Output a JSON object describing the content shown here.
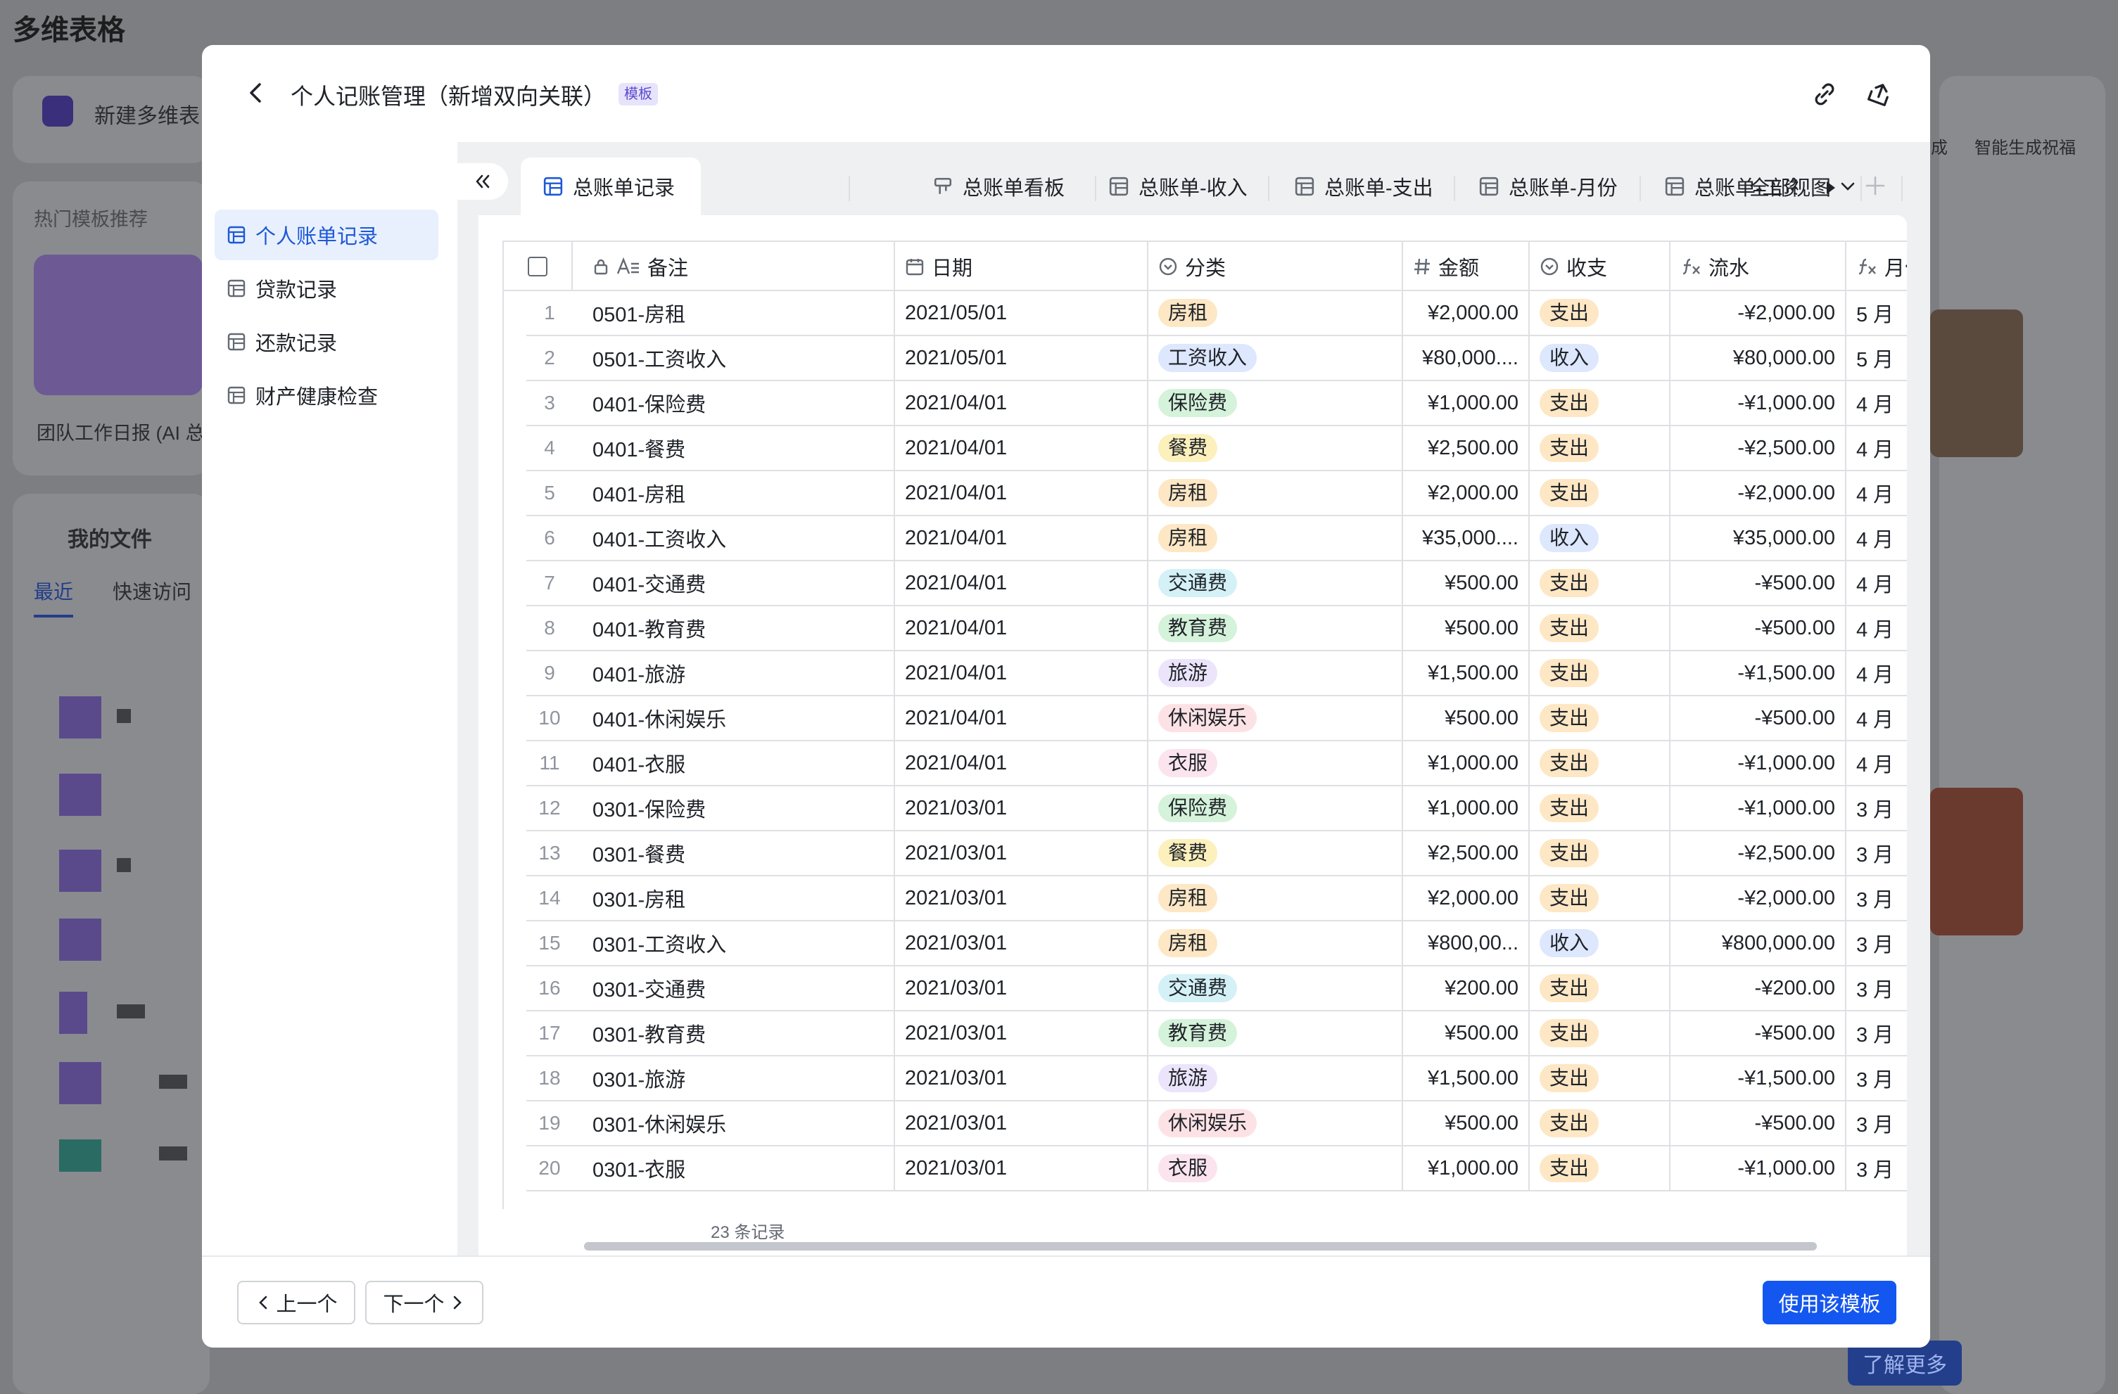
{
  "background": {
    "app_title": "多维表格",
    "new_label": "新建多维表",
    "hot_templates": "热门模板推荐",
    "template_card": "团队工作日报 (AI 总",
    "my_files": "我的文件",
    "tab_recent": "最近",
    "tab_quick": "快速访问",
    "right_text_1": "成",
    "right_text_2": "智能生成祝福",
    "learn_more": "了解更多"
  },
  "modal": {
    "title": "个人记账管理（新增双向关联）",
    "badge": "模板",
    "sidebar": [
      {
        "label": "个人账单记录",
        "active": true
      },
      {
        "label": "贷款记录",
        "active": false
      },
      {
        "label": "还款记录",
        "active": false
      },
      {
        "label": "财产健康检查",
        "active": false
      }
    ],
    "tabs": [
      {
        "label": "总账单记录",
        "icon": "grid-icon"
      },
      {
        "label": "总账单看板",
        "icon": "kanban-icon"
      },
      {
        "label": "总账单-收入",
        "icon": "grid-icon"
      },
      {
        "label": "总账单-支出",
        "icon": "grid-icon"
      },
      {
        "label": "总账单-月份",
        "icon": "grid-icon"
      },
      {
        "label": "总账单-工资",
        "icon": "grid-icon"
      }
    ],
    "all_views": "全部视图",
    "columns": {
      "note": "备注",
      "date": "日期",
      "category": "分类",
      "amount": "金额",
      "inout": "收支",
      "flow": "流水",
      "month": "月份"
    },
    "rows": [
      {
        "n": "1",
        "note": "0501-房租",
        "date": "2021/05/01",
        "cat": "房租",
        "amt": "¥2,000.00",
        "io": "支出",
        "flow": "-¥2,000.00",
        "mon": "5 月"
      },
      {
        "n": "2",
        "note": "0501-工资收入",
        "date": "2021/05/01",
        "cat": "工资收入",
        "amt": "¥80,000....",
        "io": "收入",
        "flow": "¥80,000.00",
        "mon": "5 月"
      },
      {
        "n": "3",
        "note": "0401-保险费",
        "date": "2021/04/01",
        "cat": "保险费",
        "amt": "¥1,000.00",
        "io": "支出",
        "flow": "-¥1,000.00",
        "mon": "4 月"
      },
      {
        "n": "4",
        "note": "0401-餐费",
        "date": "2021/04/01",
        "cat": "餐费",
        "amt": "¥2,500.00",
        "io": "支出",
        "flow": "-¥2,500.00",
        "mon": "4 月"
      },
      {
        "n": "5",
        "note": "0401-房租",
        "date": "2021/04/01",
        "cat": "房租",
        "amt": "¥2,000.00",
        "io": "支出",
        "flow": "-¥2,000.00",
        "mon": "4 月"
      },
      {
        "n": "6",
        "note": "0401-工资收入",
        "date": "2021/04/01",
        "cat": "房租",
        "amt": "¥35,000....",
        "io": "收入",
        "flow": "¥35,000.00",
        "mon": "4 月"
      },
      {
        "n": "7",
        "note": "0401-交通费",
        "date": "2021/04/01",
        "cat": "交通费",
        "amt": "¥500.00",
        "io": "支出",
        "flow": "-¥500.00",
        "mon": "4 月"
      },
      {
        "n": "8",
        "note": "0401-教育费",
        "date": "2021/04/01",
        "cat": "教育费",
        "amt": "¥500.00",
        "io": "支出",
        "flow": "-¥500.00",
        "mon": "4 月"
      },
      {
        "n": "9",
        "note": "0401-旅游",
        "date": "2021/04/01",
        "cat": "旅游",
        "amt": "¥1,500.00",
        "io": "支出",
        "flow": "-¥1,500.00",
        "mon": "4 月"
      },
      {
        "n": "10",
        "note": "0401-休闲娱乐",
        "date": "2021/04/01",
        "cat": "休闲娱乐",
        "amt": "¥500.00",
        "io": "支出",
        "flow": "-¥500.00",
        "mon": "4 月"
      },
      {
        "n": "11",
        "note": "0401-衣服",
        "date": "2021/04/01",
        "cat": "衣服",
        "amt": "¥1,000.00",
        "io": "支出",
        "flow": "-¥1,000.00",
        "mon": "4 月"
      },
      {
        "n": "12",
        "note": "0301-保险费",
        "date": "2021/03/01",
        "cat": "保险费",
        "amt": "¥1,000.00",
        "io": "支出",
        "flow": "-¥1,000.00",
        "mon": "3 月"
      },
      {
        "n": "13",
        "note": "0301-餐费",
        "date": "2021/03/01",
        "cat": "餐费",
        "amt": "¥2,500.00",
        "io": "支出",
        "flow": "-¥2,500.00",
        "mon": "3 月"
      },
      {
        "n": "14",
        "note": "0301-房租",
        "date": "2021/03/01",
        "cat": "房租",
        "amt": "¥2,000.00",
        "io": "支出",
        "flow": "-¥2,000.00",
        "mon": "3 月"
      },
      {
        "n": "15",
        "note": "0301-工资收入",
        "date": "2021/03/01",
        "cat": "房租",
        "amt": "¥800,00...",
        "io": "收入",
        "flow": "¥800,000.00",
        "mon": "3 月"
      },
      {
        "n": "16",
        "note": "0301-交通费",
        "date": "2021/03/01",
        "cat": "交通费",
        "amt": "¥200.00",
        "io": "支出",
        "flow": "-¥200.00",
        "mon": "3 月"
      },
      {
        "n": "17",
        "note": "0301-教育费",
        "date": "2021/03/01",
        "cat": "教育费",
        "amt": "¥500.00",
        "io": "支出",
        "flow": "-¥500.00",
        "mon": "3 月"
      },
      {
        "n": "18",
        "note": "0301-旅游",
        "date": "2021/03/01",
        "cat": "旅游",
        "amt": "¥1,500.00",
        "io": "支出",
        "flow": "-¥1,500.00",
        "mon": "3 月"
      },
      {
        "n": "19",
        "note": "0301-休闲娱乐",
        "date": "2021/03/01",
        "cat": "休闲娱乐",
        "amt": "¥500.00",
        "io": "支出",
        "flow": "-¥500.00",
        "mon": "3 月"
      },
      {
        "n": "20",
        "note": "0301-衣服",
        "date": "2021/03/01",
        "cat": "衣服",
        "amt": "¥1,000.00",
        "io": "支出",
        "flow": "-¥1,000.00",
        "mon": "3 月"
      }
    ],
    "record_count": "23 条记录",
    "prev_label": "上一个",
    "next_label": "下一个",
    "use_label": "使用该模板"
  },
  "tag_colors": {
    "房租": {
      "bg": "#fde7c4",
      "fg": "#1f2329"
    },
    "工资收入": {
      "bg": "#dde7fd",
      "fg": "#1f2329"
    },
    "保险费": {
      "bg": "#d5f2da",
      "fg": "#1f2329"
    },
    "餐费": {
      "bg": "#fcf0bc",
      "fg": "#1f2329"
    },
    "交通费": {
      "bg": "#d3f1f6",
      "fg": "#1f2329"
    },
    "教育费": {
      "bg": "#d5f2da",
      "fg": "#1f2329"
    },
    "旅游": {
      "bg": "#ebe4fb",
      "fg": "#1f2329"
    },
    "休闲娱乐": {
      "bg": "#fde2e5",
      "fg": "#1f2329"
    },
    "衣服": {
      "bg": "#fbe4ee",
      "fg": "#1f2329"
    },
    "支出": {
      "bg": "#fde7c4",
      "fg": "#1f2329"
    },
    "收入": {
      "bg": "#dde7fd",
      "fg": "#1f2329"
    }
  }
}
